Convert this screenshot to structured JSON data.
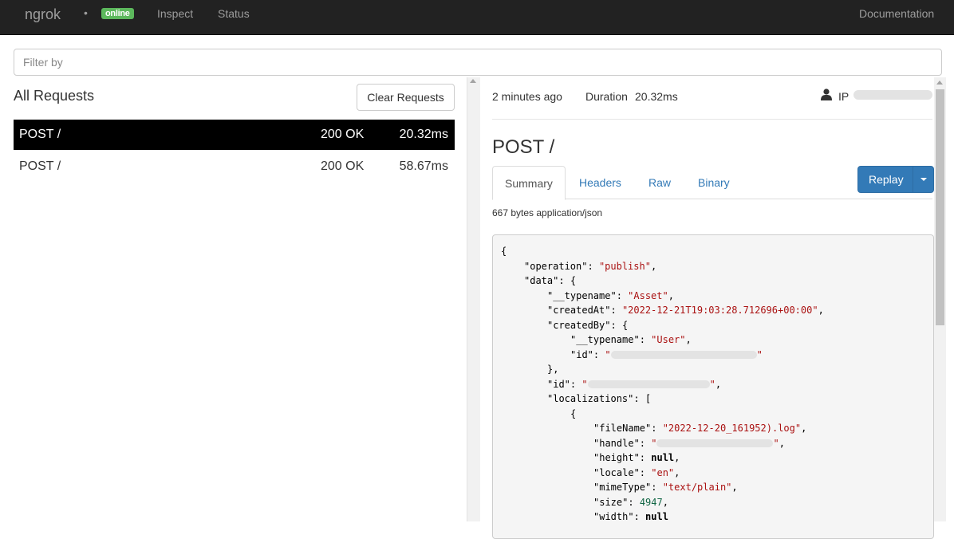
{
  "nav": {
    "brand": "ngrok",
    "status_badge": "online",
    "links": [
      "Inspect",
      "Status"
    ],
    "docs_link": "Documentation"
  },
  "filter": {
    "placeholder": "Filter by",
    "value": ""
  },
  "requests": {
    "heading": "All Requests",
    "clear_button": "Clear Requests",
    "rows": [
      {
        "method_path": "POST /",
        "status": "200 OK",
        "duration": "20.32ms",
        "selected": true
      },
      {
        "method_path": "POST /",
        "status": "200 OK",
        "duration": "58.67ms",
        "selected": false
      }
    ]
  },
  "detail": {
    "time_ago": "2 minutes ago",
    "duration_label": "Duration",
    "duration_value": "20.32ms",
    "ip_label": "IP",
    "title": "POST /",
    "tabs": [
      "Summary",
      "Headers",
      "Raw",
      "Binary"
    ],
    "active_tab": "Summary",
    "replay_button": "Replay",
    "body_info": "667 bytes application/json",
    "code_lines": [
      {
        "indent": 0,
        "text": "{"
      },
      {
        "indent": 1,
        "key": "\"operation\"",
        "val": "\"publish\"",
        "type": "s",
        "tail": ","
      },
      {
        "indent": 1,
        "key": "\"data\"",
        "val": "{",
        "type": "p",
        "tail": ""
      },
      {
        "indent": 2,
        "key": "\"__typename\"",
        "val": "\"Asset\"",
        "type": "s",
        "tail": ","
      },
      {
        "indent": 2,
        "key": "\"createdAt\"",
        "val": "\"2022-12-21T19:03:28.712696+00:00\"",
        "type": "s",
        "tail": ","
      },
      {
        "indent": 2,
        "key": "\"createdBy\"",
        "val": "{",
        "type": "p",
        "tail": ""
      },
      {
        "indent": 3,
        "key": "\"__typename\"",
        "val": "\"User\"",
        "type": "s",
        "tail": ","
      },
      {
        "indent": 3,
        "key": "\"id\"",
        "val": "redacted",
        "type": "r",
        "tail": "",
        "blur": 183
      },
      {
        "indent": 2,
        "text": "},"
      },
      {
        "indent": 2,
        "key": "\"id\"",
        "val": "redacted",
        "type": "r",
        "tail": ",",
        "blur": 153
      },
      {
        "indent": 2,
        "key": "\"localizations\"",
        "val": "[",
        "type": "p",
        "tail": ""
      },
      {
        "indent": 3,
        "text": "{"
      },
      {
        "indent": 4,
        "key": "\"fileName\"",
        "val": "\"2022-12-20_161952).log\"",
        "type": "s",
        "tail": ","
      },
      {
        "indent": 4,
        "key": "\"handle\"",
        "val": "redacted",
        "type": "r",
        "tail": ",",
        "blur": 146
      },
      {
        "indent": 4,
        "key": "\"height\"",
        "val": "null",
        "type": "l",
        "tail": ","
      },
      {
        "indent": 4,
        "key": "\"locale\"",
        "val": "\"en\"",
        "type": "s",
        "tail": ","
      },
      {
        "indent": 4,
        "key": "\"mimeType\"",
        "val": "\"text/plain\"",
        "type": "s",
        "tail": ","
      },
      {
        "indent": 4,
        "key": "\"size\"",
        "val": "4947",
        "type": "n",
        "tail": ","
      },
      {
        "indent": 4,
        "key": "\"width\"",
        "val": "null",
        "type": "l",
        "tail": ""
      }
    ]
  },
  "colors": {
    "navbar": "#222222",
    "badge": "#5cb85c",
    "link": "#337ab7",
    "string": "#aa1111",
    "number": "#116644"
  }
}
